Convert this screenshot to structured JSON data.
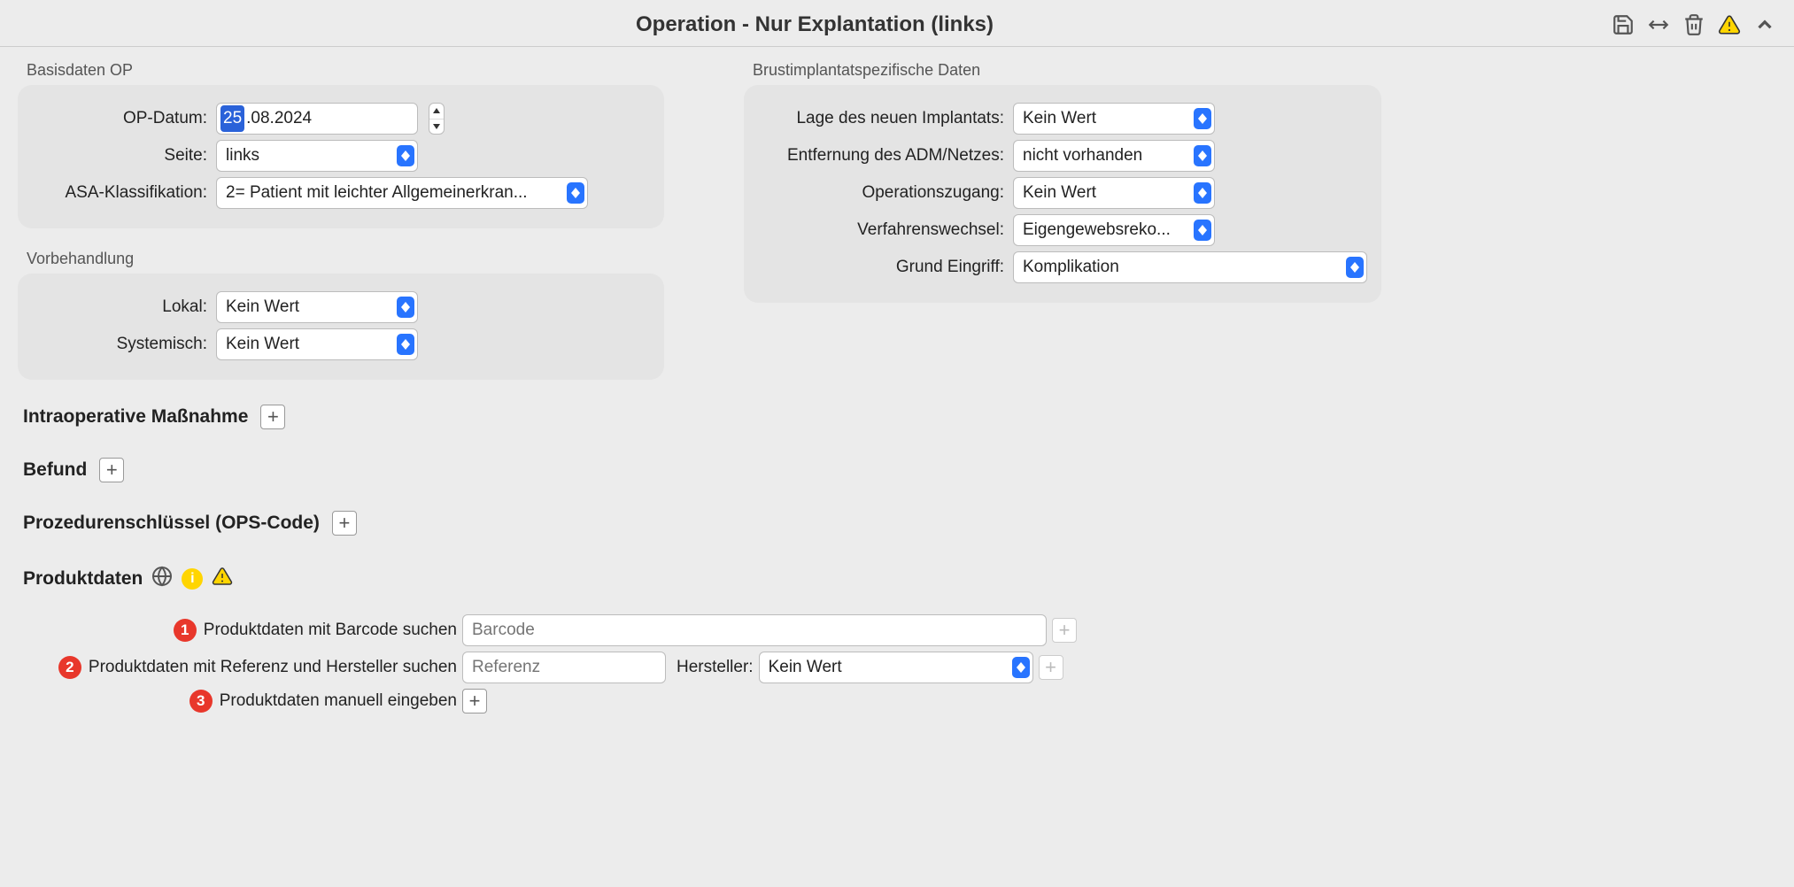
{
  "header": {
    "title": "Operation -  Nur Explantation (links)"
  },
  "basis": {
    "group_label": "Basisdaten OP",
    "op_datum_label": "OP-Datum:",
    "op_datum_highlight": "25",
    "op_datum_rest": ".08.2024",
    "seite_label": "Seite:",
    "seite_value": "links",
    "asa_label": "ASA-Klassifikation:",
    "asa_value": "2= Patient mit leichter Allgemeinerkran..."
  },
  "vorbehandlung": {
    "group_label": "Vorbehandlung",
    "lokal_label": "Lokal:",
    "lokal_value": "Kein Wert",
    "systemisch_label": "Systemisch:",
    "systemisch_value": "Kein Wert"
  },
  "brust": {
    "group_label": "Brustimplantatspezifische Daten",
    "lage_label": "Lage des neuen Implantats:",
    "lage_value": "Kein Wert",
    "entfernung_label": "Entfernung des ADM/Netzes:",
    "entfernung_value": "nicht vorhanden",
    "zugang_label": "Operationszugang:",
    "zugang_value": "Kein Wert",
    "verfahren_label": "Verfahrenswechsel:",
    "verfahren_value": "Eigengewebsreko...",
    "grund_label": "Grund Eingriff:",
    "grund_value": "Komplikation"
  },
  "sections": {
    "intra": "Intraoperative Maßnahme",
    "befund": "Befund",
    "ops": "Prozedurenschlüssel (OPS-Code)",
    "produkt": "Produktdaten"
  },
  "product": {
    "row1_num": "1",
    "row1_label": "Produktdaten mit Barcode suchen",
    "row1_placeholder": "Barcode",
    "row2_num": "2",
    "row2_label": "Produktdaten mit Referenz und Hersteller suchen",
    "row2_placeholder": "Referenz",
    "row2_hersteller_label": "Hersteller:",
    "row2_hersteller_value": "Kein Wert",
    "row3_num": "3",
    "row3_label": "Produktdaten manuell eingeben"
  }
}
